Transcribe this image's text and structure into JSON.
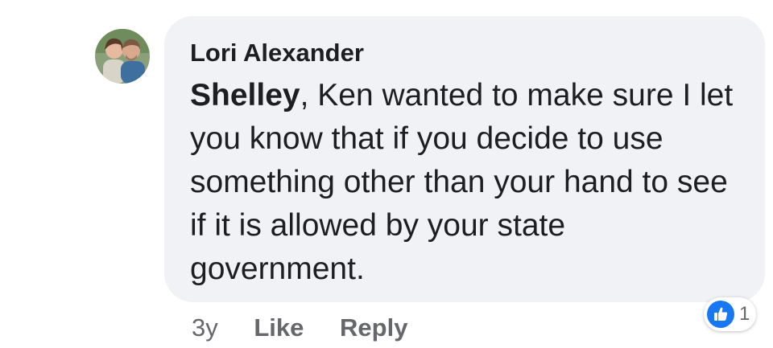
{
  "comment": {
    "author": "Lori Alexander",
    "mention": "Shelley",
    "text": ", Ken wanted to make sure I let you know that if you decide to use something other than your hand to see if it is allowed by your state government."
  },
  "actions": {
    "time": "3y",
    "like_label": "Like",
    "reply_label": "Reply"
  },
  "reactions": {
    "icon": "thumbs-up-icon",
    "count": "1",
    "color": "#1877f2"
  },
  "colors": {
    "bubble": "#f0f2f5",
    "text": "#1c1e21",
    "muted": "#65676b"
  }
}
